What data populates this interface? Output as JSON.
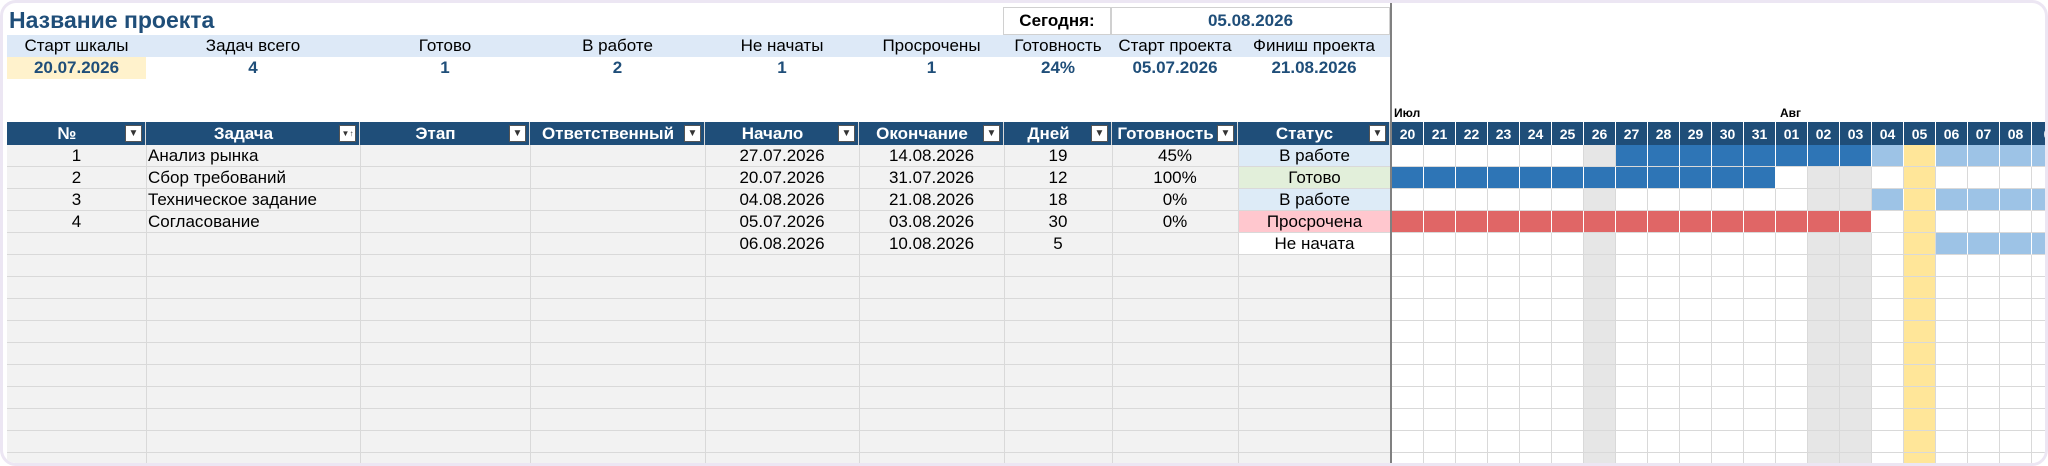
{
  "project": {
    "title": "Название проекта"
  },
  "summary": {
    "today_label": "Сегодня:",
    "today_value": "05.08.2026",
    "labels": [
      "Старт шкалы",
      "Задач всего",
      "Готово",
      "В работе",
      "Не начаты",
      "Просрочены",
      "Готовность",
      "Старт проекта",
      "Финиш проекта"
    ],
    "values": [
      "20.07.2026",
      "4",
      "1",
      "2",
      "1",
      "1",
      "24%",
      "05.07.2026",
      "21.08.2026"
    ]
  },
  "table": {
    "columns": [
      "№",
      "Задача",
      "Этап",
      "Ответственный",
      "Начало",
      "Окончание",
      "Дней",
      "Готовность",
      "Статус"
    ],
    "rows": [
      {
        "num": "1",
        "task": "Анализ рынка",
        "stage": "",
        "owner": "",
        "start": "27.07.2026",
        "end": "14.08.2026",
        "days": "19",
        "progress": "45%",
        "status": "В работе",
        "status_kind": "work"
      },
      {
        "num": "2",
        "task": "Сбор требований",
        "stage": "",
        "owner": "",
        "start": "20.07.2026",
        "end": "31.07.2026",
        "days": "12",
        "progress": "100%",
        "status": "Готово",
        "status_kind": "done"
      },
      {
        "num": "3",
        "task": "Техническое задание",
        "stage": "",
        "owner": "",
        "start": "04.08.2026",
        "end": "21.08.2026",
        "days": "18",
        "progress": "0%",
        "status": "В работе",
        "status_kind": "work"
      },
      {
        "num": "4",
        "task": "Согласование",
        "stage": "",
        "owner": "",
        "start": "05.07.2026",
        "end": "03.08.2026",
        "days": "30",
        "progress": "0%",
        "status": "Просрочена",
        "status_kind": "late"
      },
      {
        "num": "",
        "task": "",
        "stage": "",
        "owner": "",
        "start": "06.08.2026",
        "end": "10.08.2026",
        "days": "5",
        "progress": "",
        "status": "Не начата",
        "status_kind": "none"
      }
    ]
  },
  "gantt": {
    "months": [
      {
        "label": "Июл",
        "day_index": 0
      },
      {
        "label": "Авг",
        "day_index": 12
      }
    ],
    "days": [
      "20",
      "21",
      "22",
      "23",
      "24",
      "25",
      "26",
      "27",
      "28",
      "29",
      "30",
      "31",
      "01",
      "02",
      "03",
      "04",
      "05",
      "06",
      "07",
      "08",
      "0"
    ],
    "weekend_indices": [
      6,
      13,
      14
    ],
    "today_index": 16,
    "bars": [
      {
        "row": 0,
        "segments": [
          {
            "from": 7,
            "to": 15,
            "kind": "done"
          },
          {
            "from": 15,
            "to": 21,
            "kind": "todo"
          }
        ]
      },
      {
        "row": 1,
        "segments": [
          {
            "from": 0,
            "to": 12,
            "kind": "done"
          }
        ]
      },
      {
        "row": 2,
        "segments": [
          {
            "from": 15,
            "to": 21,
            "kind": "todo"
          }
        ]
      },
      {
        "row": 3,
        "segments": [
          {
            "from": 0,
            "to": 15,
            "kind": "late"
          }
        ]
      },
      {
        "row": 4,
        "segments": [
          {
            "from": 17,
            "to": 21,
            "kind": "todo"
          }
        ]
      }
    ],
    "colors": {
      "done": "#2e75b6",
      "todo": "#9dc3e6",
      "late": "#e06666",
      "weekend": "#e6e6e6",
      "today": "#ffe699"
    }
  },
  "colors": {
    "header_bg": "#1f4e79",
    "status_work": "#ddebf7",
    "status_done": "#e2efda",
    "status_late": "#ffc7ce"
  }
}
